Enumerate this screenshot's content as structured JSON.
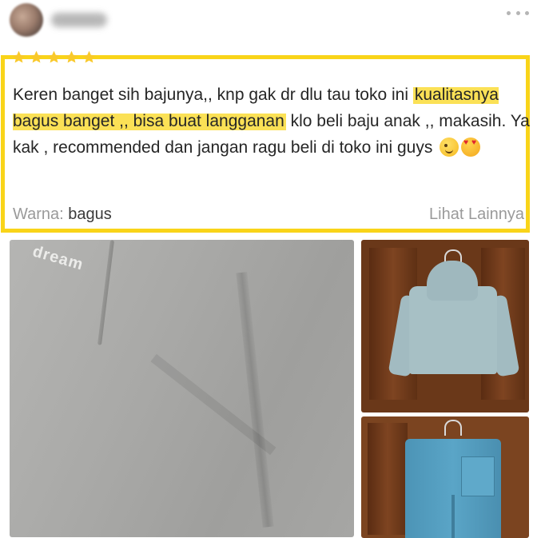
{
  "review": {
    "rating": 5,
    "text_part1": "Keren banget sih bajunya,, knp gak dr dlu tau toko ini",
    "text_highlight": "kualitasnya bagus banget ,, bisa buat langganan",
    "text_part2": " klo beli baju anak ,, makasih. Ya kak , recommended dan jangan ragu beli di toko ini guys",
    "emojis": [
      "winking-face-emoji",
      "heart-eyes-emoji"
    ],
    "variation_label": "Warna:",
    "variation_value": "bagus",
    "see_more_label": "Lihat Lainnya"
  },
  "photos": {
    "main_logo_text": "dream"
  },
  "colors": {
    "highlight_border": "#f9d419",
    "highlight_text": "#fbe156",
    "star": "#f9c92a"
  },
  "icons": {
    "menu": "more-dots-icon",
    "rating": "star-icon"
  }
}
